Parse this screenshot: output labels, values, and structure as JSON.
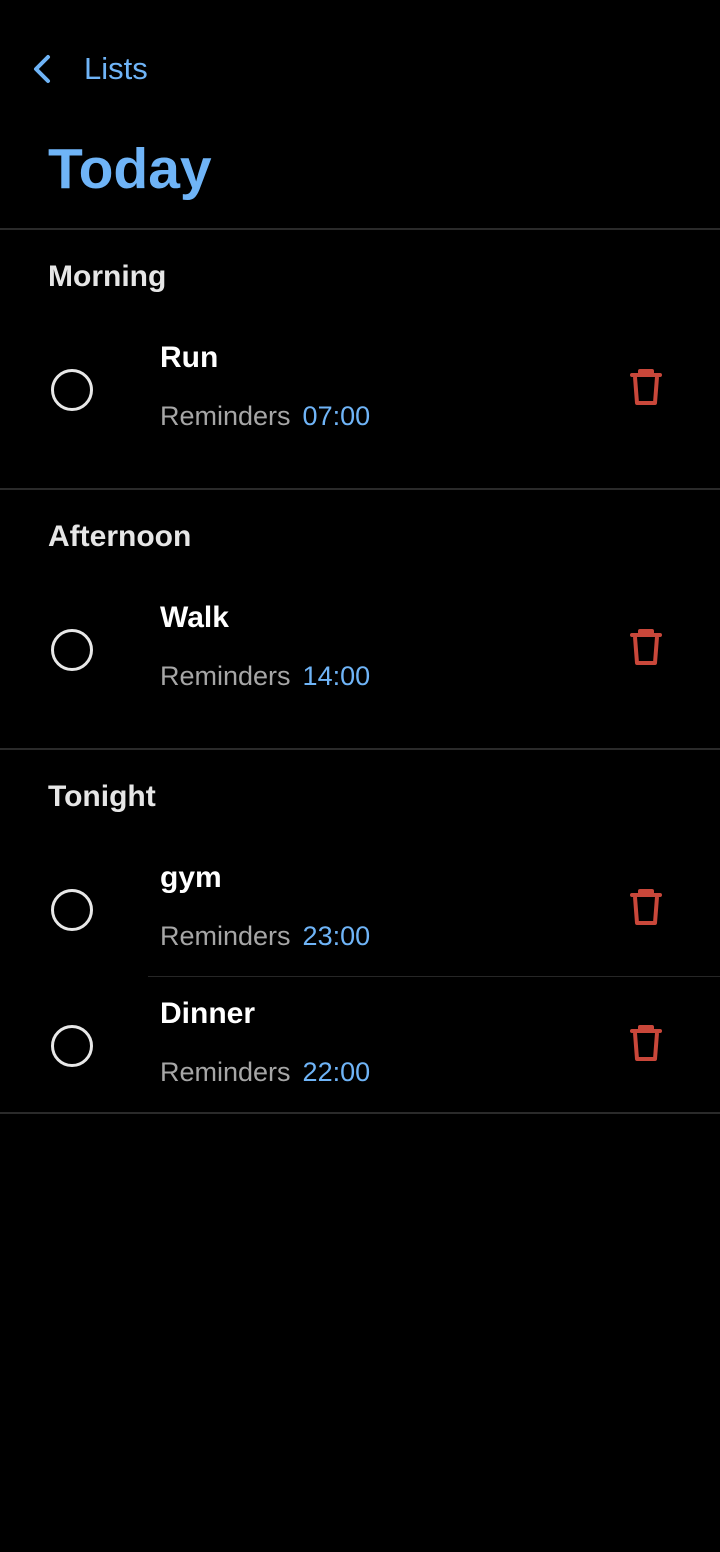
{
  "header": {
    "back_label": "Lists",
    "title": "Today"
  },
  "colors": {
    "accent": "#6FB4F7",
    "delete": "#C9473A",
    "background": "#000000",
    "divider": "#2A2A2A"
  },
  "icons": {
    "back": "chevron-left-icon",
    "checkbox": "circle-outline-icon",
    "delete": "trash-icon"
  },
  "sections": [
    {
      "title": "Morning",
      "items": [
        {
          "name": "Run",
          "label": "Reminders",
          "time": "07:00"
        }
      ]
    },
    {
      "title": "Afternoon",
      "items": [
        {
          "name": "Walk",
          "label": "Reminders",
          "time": "14:00"
        }
      ]
    },
    {
      "title": "Tonight",
      "items": [
        {
          "name": "gym",
          "label": "Reminders",
          "time": "23:00"
        },
        {
          "name": "Dinner",
          "label": "Reminders",
          "time": "22:00"
        }
      ]
    }
  ]
}
